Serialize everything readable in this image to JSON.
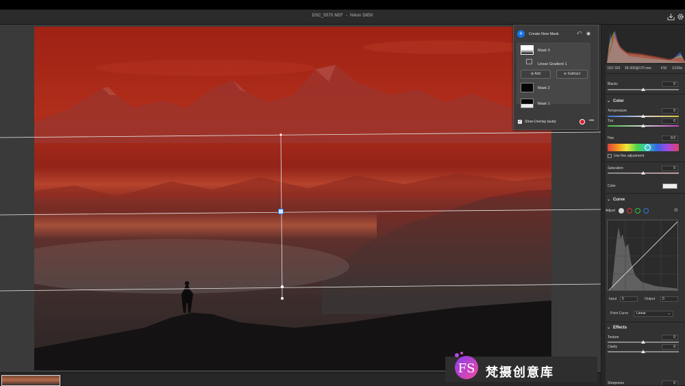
{
  "window": {
    "filename": "DSC_5570.NEF",
    "separator": "-",
    "camera": "Nikon D850"
  },
  "mask_panel": {
    "create_label": "Create New Mask",
    "masks": [
      {
        "label": "Mask 3"
      },
      {
        "label": "Linear Gradient 1"
      },
      {
        "label": "Mask 2"
      },
      {
        "label": "Mask 1"
      }
    ],
    "add_label": "Add",
    "subtract_label": "Subtract",
    "show_overlay_label": "Show Overlay (auto)",
    "overlay_color": "#e4152b",
    "more_label": "•••"
  },
  "camera_info": {
    "iso": "ISO 320",
    "lens": "28-300@170 mm",
    "aperture": "f/10",
    "shutter": "1/160s"
  },
  "panel": {
    "blacks_label": "Blacks",
    "blacks_value": "0",
    "color_section": "Color",
    "temperature_label": "Temperature",
    "temperature_value": "0",
    "tint_label": "Tint",
    "tint_value": "0",
    "hue_label": "Hue",
    "hue_value": "0.0",
    "fine_adjust_label": "Use fine adjustment",
    "saturation_label": "Saturation",
    "saturation_value": "0",
    "color_label": "Color",
    "curve_section": "Curve",
    "adjust_label": "Adjust",
    "input_label": "Input",
    "input_value": "0",
    "output_label": "Output",
    "output_value": "0",
    "point_curve_label": "Point Curve",
    "point_curve_value": "Linear",
    "effects_section": "Effects",
    "texture_label": "Texture",
    "texture_value": "0",
    "clarity_label": "Clarity",
    "clarity_value": "0",
    "sharpness_label": "Sharpness",
    "sharpness_value": "0"
  },
  "watermark": {
    "logo_text": "FS",
    "text": "梵摄创意库"
  },
  "colors": {
    "accent": "#1473e6",
    "mask_overlay": "#b01e12"
  }
}
